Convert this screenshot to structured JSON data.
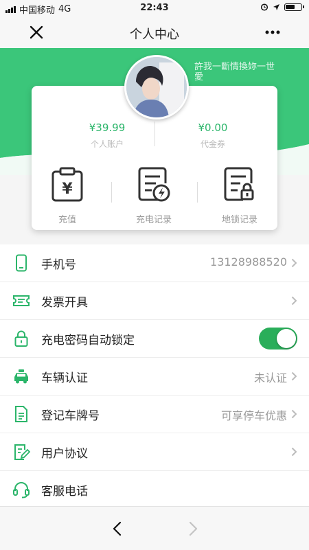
{
  "status_bar": {
    "carrier": "中国移动",
    "network": "4G",
    "time": "22:43"
  },
  "nav": {
    "title": "个人中心"
  },
  "profile": {
    "nickname": "許我一斷情換妳一世愛"
  },
  "account": {
    "balance_value": "¥39.99",
    "balance_label": "个人账户",
    "voucher_value": "¥0.00",
    "voucher_label": "代金券"
  },
  "quick_actions": [
    {
      "label": "充值",
      "icon": "recharge-clipboard-icon"
    },
    {
      "label": "充电记录",
      "icon": "charge-record-icon"
    },
    {
      "label": "地锁记录",
      "icon": "lock-record-icon"
    }
  ],
  "menu": [
    {
      "label": "手机号",
      "value": "13128988520",
      "icon": "phone-icon"
    },
    {
      "label": "发票开具",
      "value": "",
      "icon": "invoice-ticket-icon"
    },
    {
      "label": "充电密码自动锁定",
      "toggle_on": true,
      "icon": "padlock-icon"
    },
    {
      "label": "车辆认证",
      "value": "未认证",
      "icon": "taxi-icon"
    },
    {
      "label": "登记车牌号",
      "value": "可享停车优惠",
      "icon": "document-icon"
    },
    {
      "label": "用户协议",
      "value": "",
      "icon": "edit-document-icon"
    },
    {
      "label": "客服电话",
      "value": "",
      "icon": "headset-icon"
    }
  ],
  "colors": {
    "accent": "#2BB56A",
    "header_green": "#3BC67A"
  }
}
